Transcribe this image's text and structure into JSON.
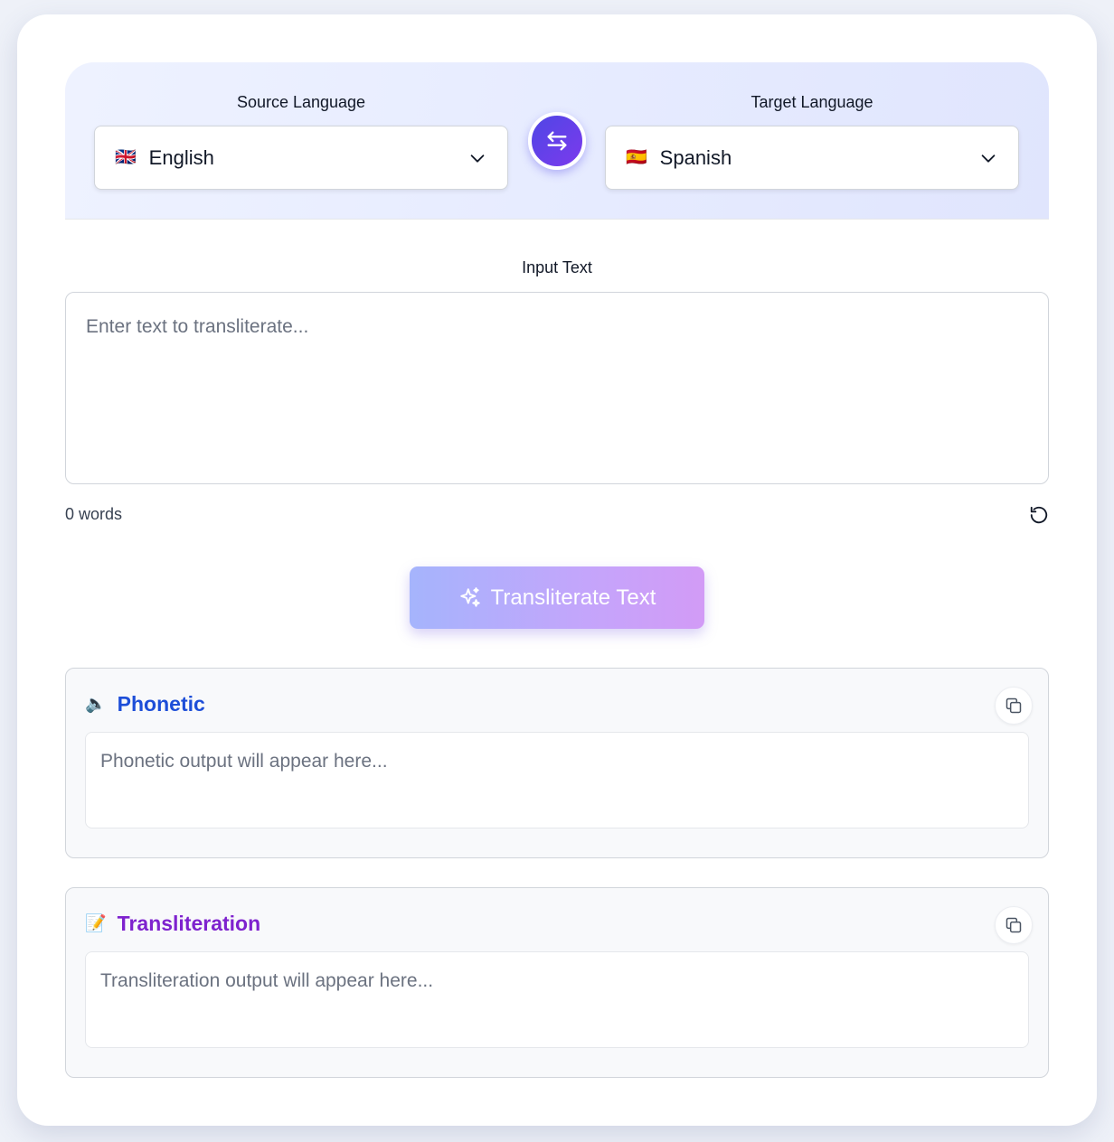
{
  "source": {
    "label": "Source Language",
    "flag": "🇬🇧",
    "language": "English"
  },
  "target": {
    "label": "Target Language",
    "flag": "🇪🇸",
    "language": "Spanish"
  },
  "input": {
    "label": "Input Text",
    "placeholder": "Enter text to transliterate...",
    "value": ""
  },
  "word_count": "0 words",
  "transliterate_button": {
    "label": "Transliterate Text",
    "icon": "sparkles-icon"
  },
  "outputs": {
    "phonetic": {
      "emoji": "🔈",
      "title": "Phonetic",
      "placeholder": "Phonetic output will appear here...",
      "color": "#1d4ed8"
    },
    "transliteration": {
      "emoji": "📝",
      "title": "Transliteration",
      "placeholder": "Transliteration output will appear here...",
      "color": "#7e22ce"
    }
  },
  "colors": {
    "accent_start": "#4f46e5",
    "accent_end": "#7c3aed"
  }
}
